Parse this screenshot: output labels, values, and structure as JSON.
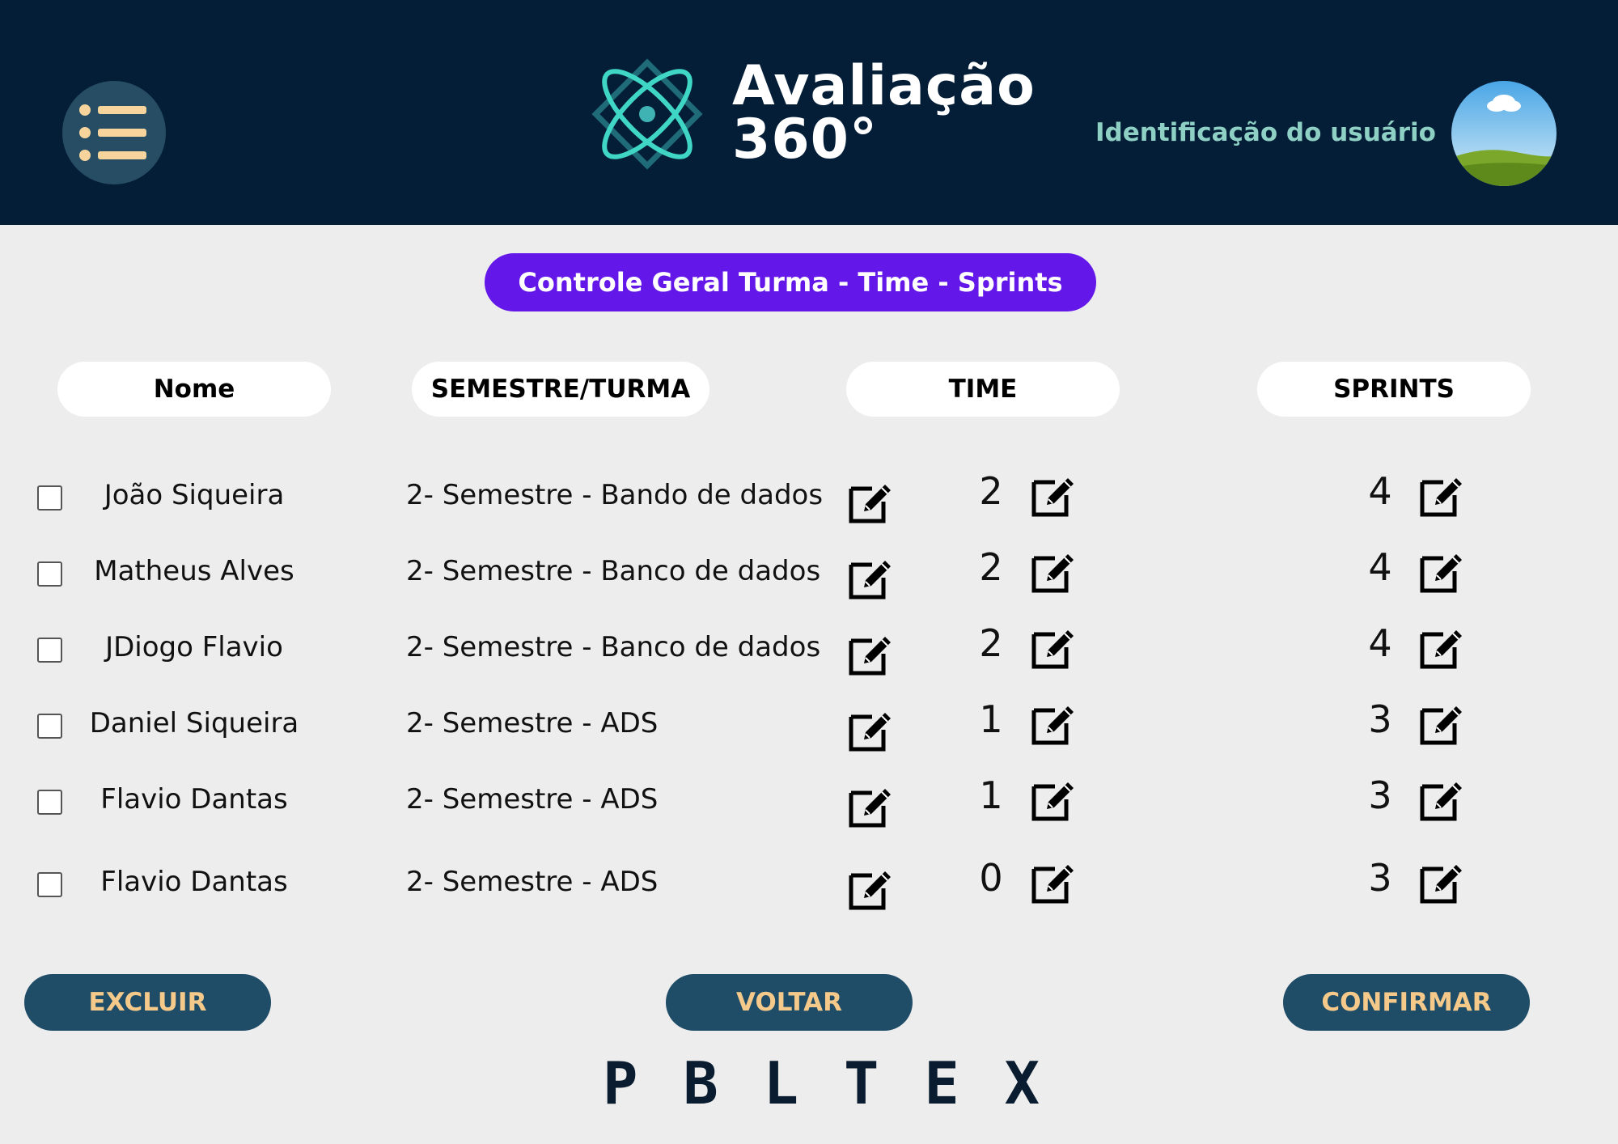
{
  "header": {
    "brand_line1": "Avaliação",
    "brand_line2": "360°",
    "user_label": "Identificação do usuário",
    "colors": {
      "background": "#041e38",
      "accent": "#8fd0c5",
      "menu_bg": "#264d63"
    },
    "icons": {
      "menu": "list-menu-icon",
      "logo": "atom-icon",
      "avatar": "landscape-avatar"
    }
  },
  "page_title": "Controle Geral Turma - Time - Sprints",
  "columns": {
    "nome": "Nome",
    "turma": "SEMESTRE/TURMA",
    "time": "TIME",
    "sprints": "SPRINTS"
  },
  "rows": [
    {
      "name": "João Siqueira",
      "turma": "2- Semestre - Bando de dados",
      "time": "2",
      "sprints": "4",
      "checked": false
    },
    {
      "name": "Matheus Alves",
      "turma": "2- Semestre - Banco de dados",
      "time": "2",
      "sprints": "4",
      "checked": false
    },
    {
      "name": "JDiogo  Flavio",
      "turma": "2- Semestre - Banco de dados",
      "time": "2",
      "sprints": "4",
      "checked": false
    },
    {
      "name": "Daniel Siqueira",
      "turma": "2- Semestre - ADS",
      "time": "1",
      "sprints": "3",
      "checked": false
    },
    {
      "name": "Flavio Dantas",
      "turma": "2- Semestre - ADS",
      "time": "1",
      "sprints": "3",
      "checked": false
    },
    {
      "name": "Flavio Dantas",
      "turma": "2- Semestre - ADS",
      "time": "0",
      "sprints": "3",
      "checked": false
    }
  ],
  "buttons": {
    "excluir": "EXCLUIR",
    "voltar": "VOLTAR",
    "confirmar": "CONFIRMAR"
  },
  "footer": {
    "letters": [
      "P",
      "B",
      "L",
      "T",
      "E",
      "X"
    ]
  },
  "colors": {
    "title_pill": "#6317e8",
    "button_bg": "#1f4c67",
    "button_text": "#f5c98a",
    "page_bg": "#ededed"
  }
}
